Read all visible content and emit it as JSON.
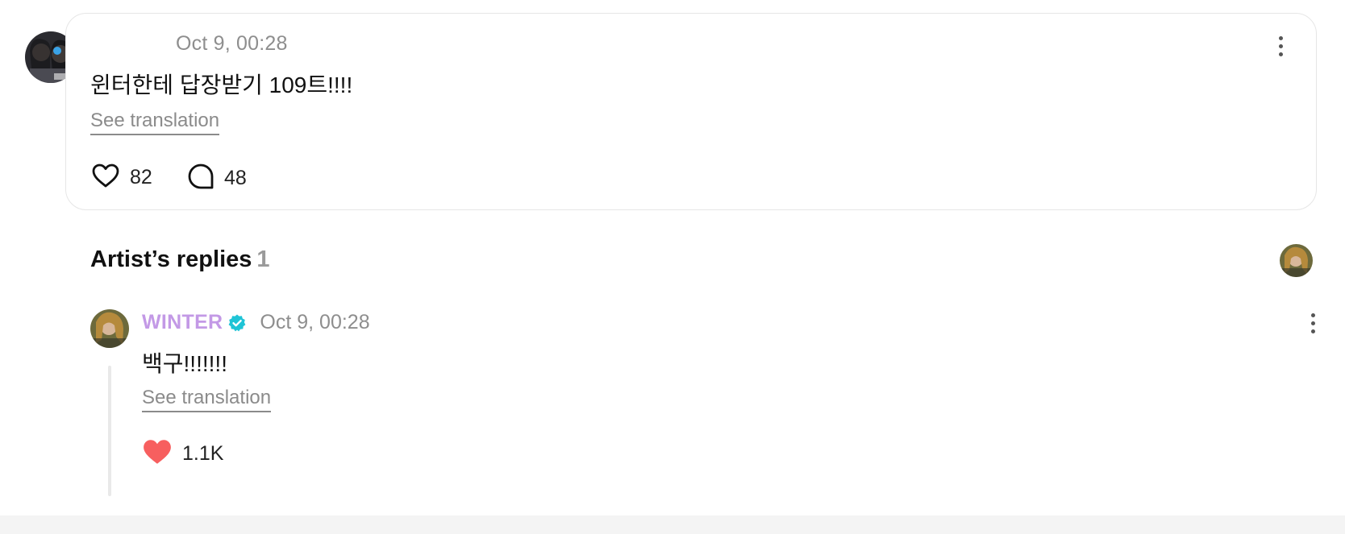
{
  "post": {
    "timestamp": "Oct 9, 00:28",
    "body": "윈터한테 답장받기 109트!!!!",
    "see_translation": "See translation",
    "likes": "82",
    "comments": "48"
  },
  "artist_replies": {
    "title": "Artist’s replies",
    "count": "1"
  },
  "reply": {
    "author": "WINTER",
    "timestamp": "Oct 9, 00:28",
    "body": "백구!!!!!!!",
    "see_translation": "See translation",
    "likes": "1.1K"
  },
  "colors": {
    "author_name": "#c399e6",
    "verified_badge": "#1fc4d6",
    "liked_heart": "#f75f5f",
    "muted_text": "#8e8e8e"
  },
  "icons": {
    "post_like": "heart-outline-icon",
    "post_comment": "speech-bubble-icon",
    "reply_like": "heart-filled-icon",
    "verified": "verified-badge-icon",
    "more": "more-vertical-icon"
  }
}
